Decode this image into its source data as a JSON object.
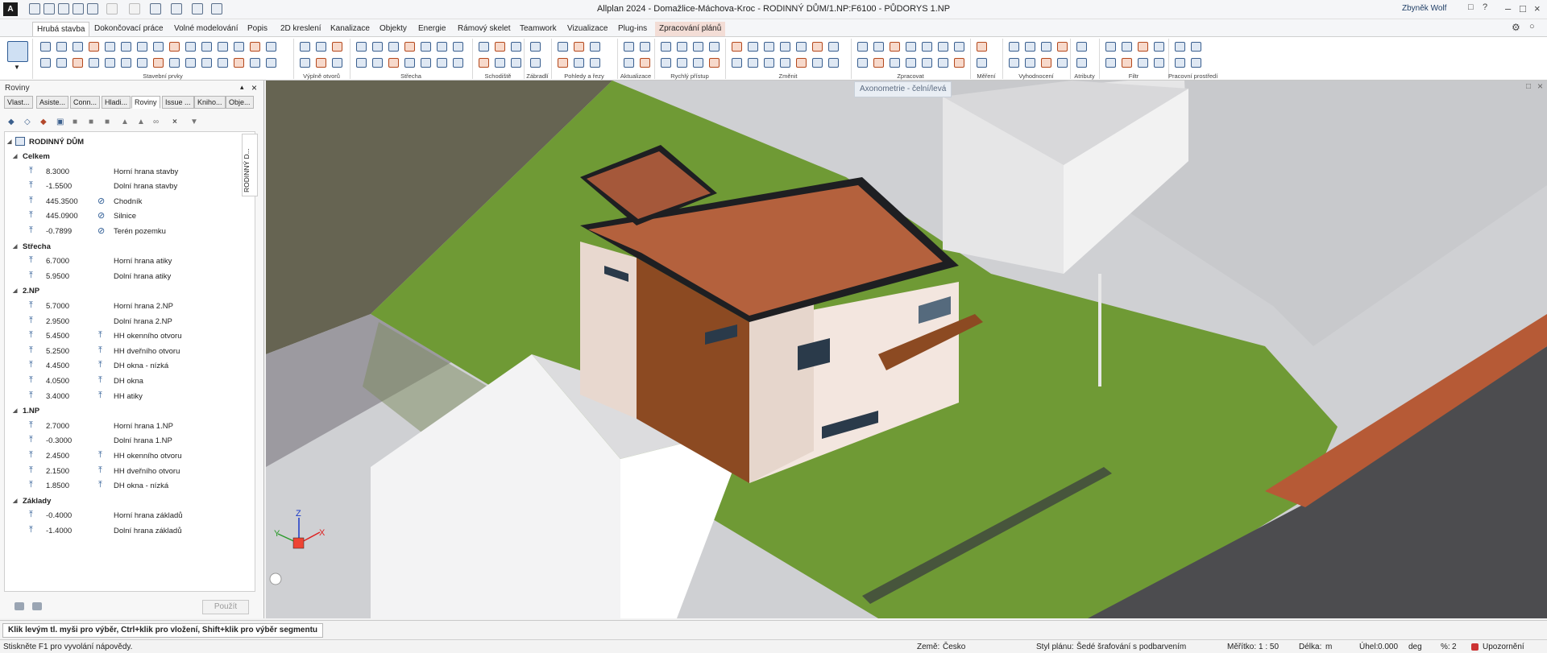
{
  "title": "Allplan 2024 - Domažlice-Máchova-Kroc - RODINNÝ DŮM/1.NP:F6100 - PŮDORYS 1.NP",
  "user": "Zbyněk Wolf",
  "logo": "A",
  "ribbon_tabs": [
    "Hrubá stavba",
    "Dokončovací práce",
    "Volné modelování",
    "Popis",
    "2D kreslení",
    "Kanalizace",
    "Objekty",
    "Energie",
    "Rámový skelet",
    "Teamwork",
    "Vizualizace",
    "Plug-ins",
    "Zpracování plánů"
  ],
  "ribbon_groups": [
    "Stavební prvky",
    "Výplně otvorů",
    "Střecha",
    "Schodiště",
    "Zábradlí",
    "Pohledy a řezy",
    "Aktualizace",
    "Rychlý přístup",
    "Změnit",
    "Zpracovat",
    "Měření",
    "Vyhodnocení",
    "Atributy",
    "Filtr",
    "Pracovní prostředí"
  ],
  "panel": {
    "title": "Roviny",
    "tabs": [
      "Vlast...",
      "Asiste...",
      "Conn...",
      "Hladi...",
      "Roviny",
      "Issue ...",
      "Kniho...",
      "Obje..."
    ],
    "side_tab": "RODINNÝ D...",
    "root": "RODINNÝ DŮM",
    "rows": [
      {
        "kind": "group",
        "label": "Celkem"
      },
      {
        "kind": "plane",
        "value": "8.3000",
        "label": "Horní hrana stavby"
      },
      {
        "kind": "plane",
        "value": "-1.5500",
        "label": "Dolní hrana stavby"
      },
      {
        "kind": "plane",
        "value": "445.3500",
        "label": "Chodník",
        "flag": "no"
      },
      {
        "kind": "plane",
        "value": "445.0900",
        "label": "Silnice",
        "flag": "no"
      },
      {
        "kind": "plane",
        "value": "-0.7899",
        "label": "Terén pozemku",
        "flag": "no"
      },
      {
        "kind": "group",
        "label": "Střecha"
      },
      {
        "kind": "plane",
        "value": "6.7000",
        "label": "Horní hrana atiky"
      },
      {
        "kind": "plane",
        "value": "5.9500",
        "label": "Dolní hrana atiky"
      },
      {
        "kind": "group",
        "label": "2.NP"
      },
      {
        "kind": "plane",
        "value": "5.7000",
        "label": "Horní hrana 2.NP"
      },
      {
        "kind": "plane",
        "value": "2.9500",
        "label": "Dolní hrana 2.NP"
      },
      {
        "kind": "plane",
        "value": "5.4500",
        "label": "HH okenního otvoru",
        "flag": "up"
      },
      {
        "kind": "plane",
        "value": "5.2500",
        "label": "HH dveřního otvoru",
        "flag": "up"
      },
      {
        "kind": "plane",
        "value": "4.4500",
        "label": "DH okna - nízká",
        "flag": "up"
      },
      {
        "kind": "plane",
        "value": "4.0500",
        "label": "DH okna",
        "flag": "up"
      },
      {
        "kind": "plane",
        "value": "3.4000",
        "label": "HH atiky",
        "flag": "up"
      },
      {
        "kind": "group",
        "label": "1.NP"
      },
      {
        "kind": "plane",
        "value": "2.7000",
        "label": "Horní hrana 1.NP"
      },
      {
        "kind": "plane",
        "value": "-0.3000",
        "label": "Dolní hrana 1.NP"
      },
      {
        "kind": "plane",
        "value": "2.4500",
        "label": "HH okenního otvoru",
        "flag": "up"
      },
      {
        "kind": "plane",
        "value": "2.1500",
        "label": "HH dveřního otvoru",
        "flag": "up"
      },
      {
        "kind": "plane",
        "value": "1.8500",
        "label": "DH okna - nízká",
        "flag": "up"
      },
      {
        "kind": "group",
        "label": "Základy"
      },
      {
        "kind": "plane",
        "value": "-0.4000",
        "label": "Horní hrana základů"
      },
      {
        "kind": "plane",
        "value": "-1.4000",
        "label": "Dolní hrana základů"
      }
    ],
    "apply_label": "Použít"
  },
  "viewport": {
    "label": "Axonometrie - čelní/levá",
    "axes": {
      "x": "X",
      "y": "Y",
      "z": "Z"
    }
  },
  "command_line": "Klik levým tl. myši pro výběr, Ctrl+klik pro vložení, Shift+klik pro výběr segmentu",
  "status": {
    "hint": "Stiskněte F1 pro vyvolání nápovědy.",
    "country_label": "Země:",
    "country": "Česko",
    "plan_style_label": "Styl plánu:",
    "plan_style": "Šedé šrafování s podbarvením",
    "scale_label": "Měřítko:",
    "scale": "1 : 50",
    "length_label": "Délka:",
    "length_unit": "m",
    "angle_label": "Úhel:",
    "angle": "0.000",
    "angle_unit": "deg",
    "percent_label": "%:",
    "percent": "2",
    "mode": "Upozornění"
  },
  "colors": {
    "accent": "#1f5fa8",
    "roof": "#b4613d",
    "rust": "#8c4a22",
    "grass": "#6f9a35",
    "facade": "#f2e4dc",
    "terrain": "#6b6a5c"
  }
}
